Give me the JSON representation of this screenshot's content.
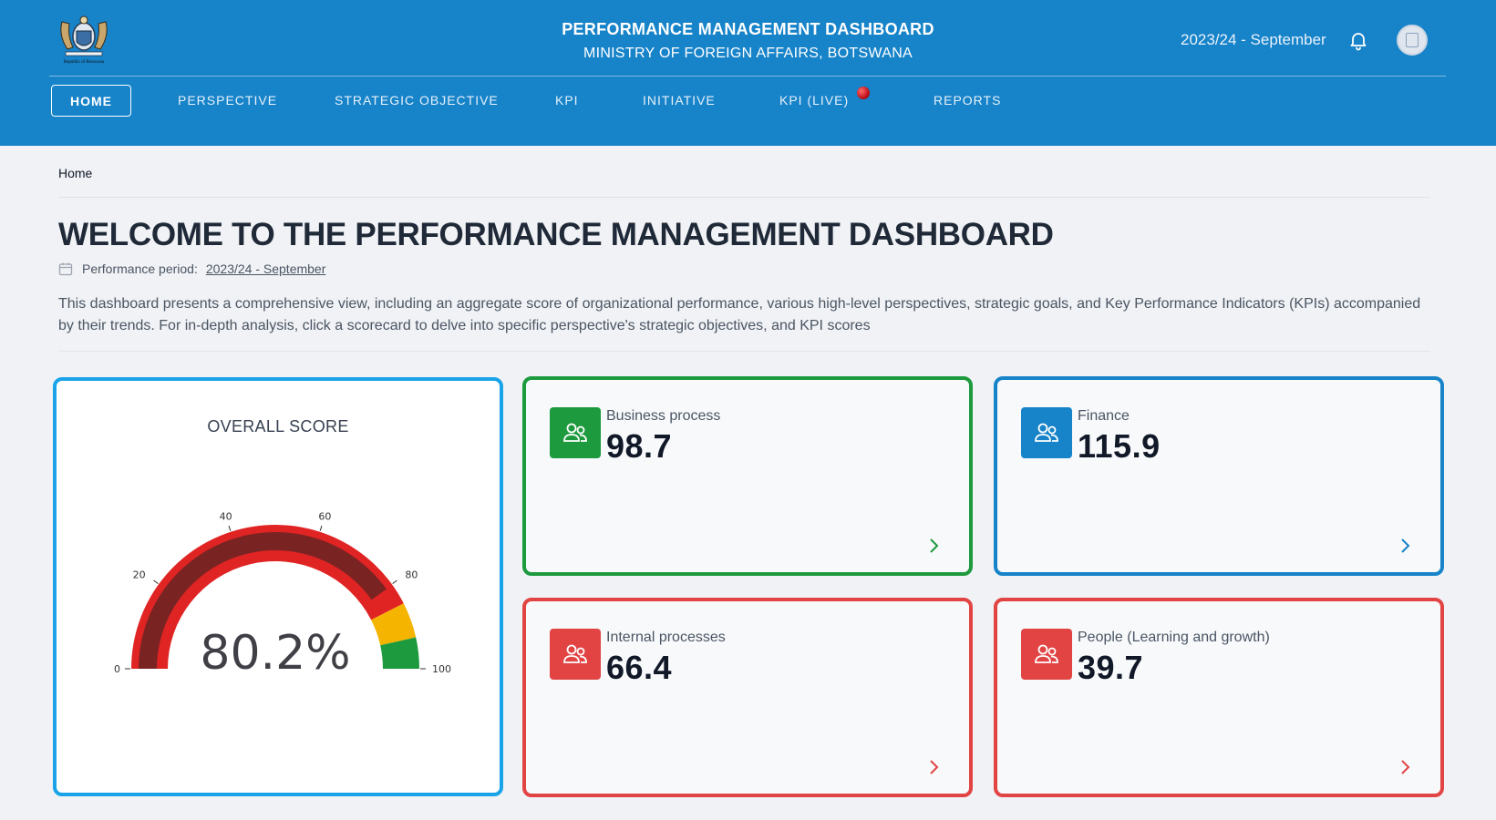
{
  "header": {
    "logo_text": "Republic of Botswana",
    "title": "PERFORMANCE MANAGEMENT DASHBOARD",
    "subtitle": "MINISTRY OF FOREIGN AFFAIRS, BOTSWANA",
    "period": "2023/24 - September",
    "bell_icon": "bell-icon",
    "avatar_icon": "avatar-icon"
  },
  "nav": {
    "items": [
      {
        "label": "HOME",
        "active": true
      },
      {
        "label": "PERSPECTIVE"
      },
      {
        "label": "STRATEGIC OBJECTIVE"
      },
      {
        "label": "KPI"
      },
      {
        "label": "INITIATIVE"
      },
      {
        "label": "KPI (LIVE)",
        "live": true
      },
      {
        "label": "REPORTS"
      }
    ]
  },
  "breadcrumb": "Home",
  "page": {
    "title": "WELCOME TO THE PERFORMANCE MANAGEMENT DASHBOARD",
    "period_label": "Performance period:",
    "period_value": "2023/24 - September",
    "description": "This dashboard presents a comprehensive view, including an aggregate score of organizational performance, various high-level perspectives, strategic goals, and Key Performance Indicators (KPIs) accompanied by their trends. For in-depth analysis, click a scorecard to delve into specific perspective's strategic objectives, and KPI scores"
  },
  "overall": {
    "title": "OVERALL SCORE",
    "value_text": "80.2%",
    "value": 80.2,
    "min": 0,
    "max": 100,
    "ticks": [
      "0",
      "20",
      "40",
      "60",
      "80",
      "100"
    ],
    "bands": [
      {
        "from": 0,
        "to": 85,
        "color": "#e02424"
      },
      {
        "from": 85,
        "to": 93,
        "color": "#f5b400"
      },
      {
        "from": 93,
        "to": 100,
        "color": "#1e9a3e"
      }
    ],
    "bar_color": "#7a2323"
  },
  "perspectives": {
    "business": {
      "label": "Business process",
      "value": "98.7",
      "color": "#1e9a3e",
      "icon": "users-icon"
    },
    "finance": {
      "label": "Finance",
      "value": "115.9",
      "color": "#1783c9",
      "icon": "users-icon"
    },
    "internal": {
      "label": "Internal processes",
      "value": "66.4",
      "color": "#e24444",
      "icon": "users-icon"
    },
    "people": {
      "label": "People (Learning and growth)",
      "value": "39.7",
      "color": "#e24444",
      "icon": "users-icon"
    }
  }
}
